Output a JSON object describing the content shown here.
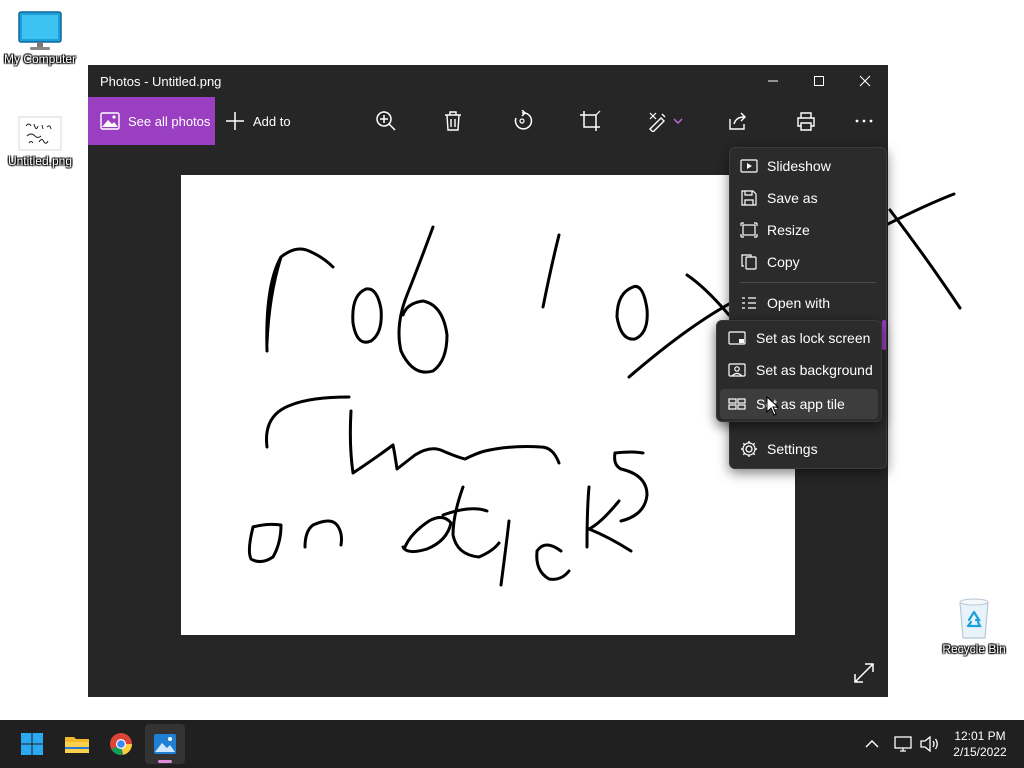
{
  "desktop": {
    "icons": [
      {
        "label": "My Computer"
      },
      {
        "label": "Untitled.png"
      },
      {
        "label": "Recycle Bin"
      }
    ]
  },
  "window": {
    "title": "Photos - Untitled.png",
    "toolbar": {
      "see_all_photos": "See all photos",
      "add_to": "Add to"
    }
  },
  "context_menu": {
    "items": [
      {
        "label": "Slideshow",
        "icon": "slideshow-icon"
      },
      {
        "label": "Save as",
        "icon": "save-icon"
      },
      {
        "label": "Resize",
        "icon": "resize-icon"
      },
      {
        "label": "Copy",
        "icon": "copy-icon"
      },
      {
        "label": "Open with",
        "icon": "open-with-icon"
      },
      {
        "label": "Settings",
        "icon": "gear-icon"
      }
    ],
    "submenu": [
      {
        "label": "Set as lock screen",
        "icon": "lock-screen-icon"
      },
      {
        "label": "Set as background",
        "icon": "background-icon"
      },
      {
        "label": "Set as app tile",
        "icon": "app-tile-icon"
      }
    ]
  },
  "taskbar": {
    "time": "12:01 PM",
    "date": "2/15/2022"
  },
  "colors": {
    "accent": "#9a3fc2",
    "window_bg": "#262626",
    "taskbar_bg": "#202020"
  }
}
